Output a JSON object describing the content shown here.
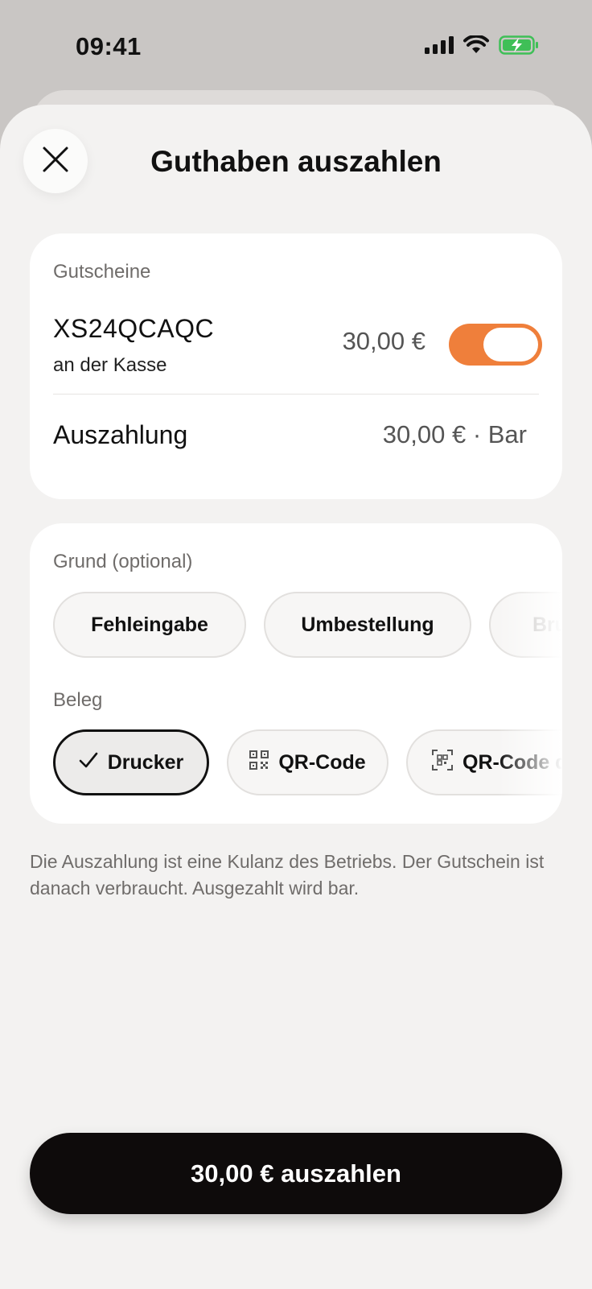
{
  "status_bar": {
    "time": "09:41",
    "icons": [
      "cellular-signal-icon",
      "wifi-icon",
      "battery-charging-icon"
    ],
    "battery_color": "#3fbf57"
  },
  "sheet": {
    "title": "Guthaben auszahlen",
    "close_icon": "close-icon"
  },
  "vouchers": {
    "section_label": "Gutscheine",
    "code": "XS24QCAQC",
    "location": "an der Kasse",
    "amount": "30,00 €",
    "toggle_on": true,
    "toggle_color": "#ef7f3b",
    "payout_label": "Auszahlung",
    "payout_value": "30,00 € · Bar"
  },
  "reason": {
    "section_label": "Grund (optional)",
    "options": [
      "Fehleingabe",
      "Umbestellung",
      "Bru"
    ]
  },
  "receipt": {
    "section_label": "Beleg",
    "options": [
      {
        "label": "Drucker",
        "icon": "checkmark-icon",
        "selected": true
      },
      {
        "label": "QR-Code",
        "icon": "qr-code-icon",
        "selected": false
      },
      {
        "label": "QR-Code d",
        "icon": "qr-scan-icon",
        "selected": false
      }
    ]
  },
  "info_text": "Die Auszahlung ist eine Kulanz des Betriebs. Der Gutschein ist danach verbraucht. Ausgezahlt wird bar.",
  "cta": {
    "label": "30,00 € auszahlen"
  }
}
